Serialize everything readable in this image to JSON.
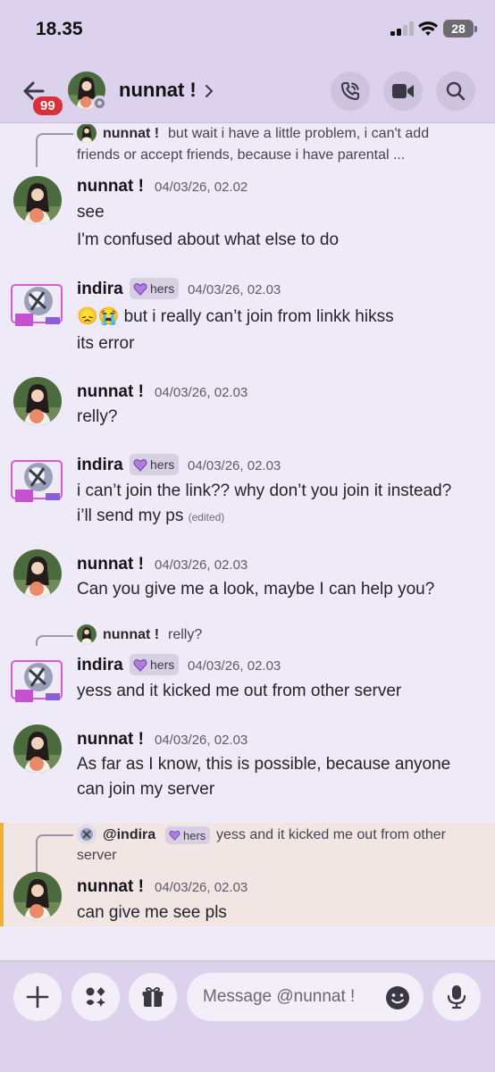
{
  "status_bar": {
    "time": "18.35",
    "battery": "28"
  },
  "header": {
    "name": "nunnat !",
    "unread_badge": "99"
  },
  "messages": [
    {
      "type": "reply",
      "reply_name": "nunnat !",
      "reply_text_line1": "but wait i have a little problem, i can't add",
      "reply_text_line2": "friends or accept friends, because i have parental ..."
    },
    {
      "author": "nunnat !",
      "time": "04/03/26, 02.02",
      "lines": [
        "see",
        "I'm confused about what else to do"
      ]
    },
    {
      "author": "indira",
      "tag": "hers",
      "time": "04/03/26, 02.03",
      "lines": [
        "😞😭 but i really can’t join from linkk hikss",
        "its error"
      ]
    },
    {
      "author": "nunnat !",
      "time": "04/03/26, 02.03",
      "lines": [
        "relly?"
      ]
    },
    {
      "author": "indira",
      "tag": "hers",
      "time": "04/03/26, 02.03",
      "lines": [
        "i can’t join the link??  why don’t you join it instead?",
        "i’ll send my ps"
      ],
      "edited": "(edited)"
    },
    {
      "author": "nunnat !",
      "time": "04/03/26, 02.03",
      "lines": [
        "Can you give me a look, maybe I can help you?"
      ]
    },
    {
      "type": "reply",
      "reply_name": "nunnat !",
      "reply_text": "relly?"
    },
    {
      "author": "indira",
      "tag": "hers",
      "time": "04/03/26, 02.03",
      "lines": [
        "yess and it kicked me out from other server"
      ]
    },
    {
      "author": "nunnat !",
      "time": "04/03/26, 02.03",
      "lines": [
        "As far as I know, this is possible, because anyone",
        "can join my server"
      ]
    },
    {
      "type": "reply",
      "reply_name": "@indira",
      "reply_tag": "hers",
      "reply_text_line1": "yess and it kicked me out from other",
      "reply_text_line2": "server"
    },
    {
      "author": "nunnat !",
      "time": "04/03/26, 02.03",
      "lines": [
        "can give me see pls"
      ]
    }
  ],
  "composer": {
    "placeholder": "Message @nunnat !"
  },
  "icons": [
    "back-arrow-icon",
    "chevron-right-icon",
    "phone-call-icon",
    "video-camera-icon",
    "search-icon",
    "plus-icon",
    "apps-icon",
    "gift-icon",
    "emoji-icon",
    "microphone-icon"
  ],
  "colors": {
    "header_bg": "#dcd2ee",
    "chat_bg": "#efeaf7",
    "unread_badge": "#d9303a",
    "mention_highlight": "#f1e6e4",
    "mention_bar": "#f0b132"
  }
}
